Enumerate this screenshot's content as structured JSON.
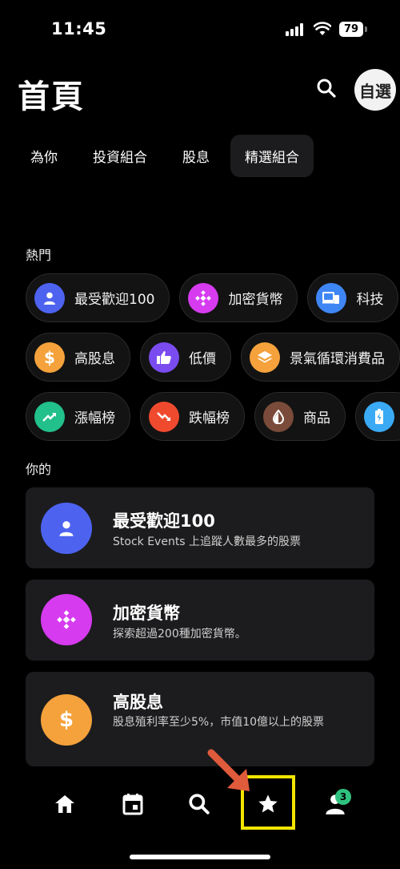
{
  "status": {
    "time": "11:45",
    "battery": "79"
  },
  "header": {
    "title": "首頁",
    "avatar_label": "自選"
  },
  "tabs": [
    {
      "label": "為你"
    },
    {
      "label": "投資組合"
    },
    {
      "label": "股息"
    },
    {
      "label": "精選組合",
      "active": true
    }
  ],
  "hot": {
    "label": "熱門",
    "row1": [
      {
        "label": "最受歡迎100",
        "icon": "person-icon",
        "color": "#4d63f0"
      },
      {
        "label": "加密貨幣",
        "icon": "crypto-icon",
        "color": "#d63bf0"
      },
      {
        "label": "科技",
        "icon": "devices-icon",
        "color": "#3f86f5"
      }
    ],
    "row2": [
      {
        "label": "高股息",
        "icon": "dollar-icon",
        "color": "#f5a23c"
      },
      {
        "label": "低價",
        "icon": "thumbs-up-icon",
        "color": "#7a4cf0"
      },
      {
        "label": "景氣循環消費品",
        "icon": "layers-icon",
        "color": "#f5a23c"
      }
    ],
    "row3": [
      {
        "label": "漲幅榜",
        "icon": "trending-up-icon",
        "color": "#22c08a"
      },
      {
        "label": "跌幅榜",
        "icon": "trending-down-icon",
        "color": "#f04a2e"
      },
      {
        "label": "商品",
        "icon": "drop-icon",
        "color": "#7a4b3a"
      },
      {
        "label": "",
        "icon": "battery-icon",
        "color": "#3aaaf5"
      }
    ]
  },
  "yours": {
    "label": "你的",
    "cards": [
      {
        "title": "最受歡迎100",
        "subtitle": "Stock Events 上追蹤人數最多的股票",
        "color": "#4d63f0"
      },
      {
        "title": "加密貨幣",
        "subtitle": "探索超過200種加密貨幣。",
        "color": "#d63bf0"
      },
      {
        "title": "高股息",
        "subtitle": "股息殖利率至少5%，市值10億以上的股票",
        "color": "#f5a23c"
      }
    ]
  },
  "nav": {
    "badge": "3"
  }
}
